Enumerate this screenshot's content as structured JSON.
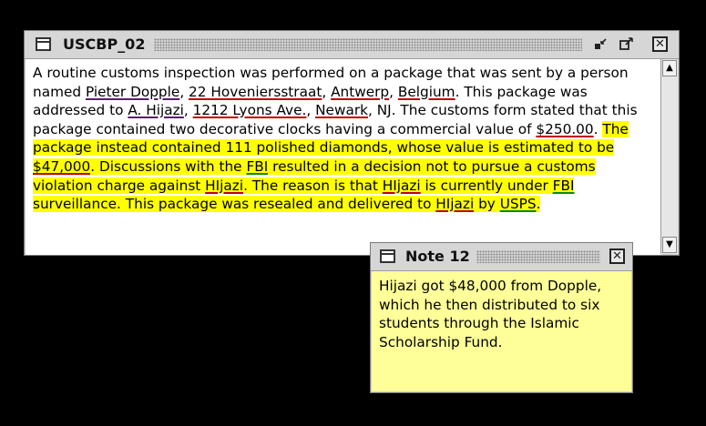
{
  "main_window": {
    "title": "USCBP_02",
    "minimize_glyph": "▫↙",
    "maximize_glyph": "↗",
    "close_glyph": "✕",
    "text": {
      "p1": "A routine customs inspection was performed on a package that was sent by a person named ",
      "name1": "Pieter Dopple",
      "sep1": ", ",
      "addr1": "22 Hoveniersstraat",
      "sep2": ", ",
      "city1": "Antwerp",
      "sep3": ", ",
      "country1": "Belgium",
      "p2": ". This package was addressed to ",
      "name2": "A. Hijazi",
      "sep4": ", ",
      "addr2": "1212 Lyons Ave.",
      "sep5": ", ",
      "city2": "Newark",
      "p3": ", NJ. The customs form stated that this package contained two decorative clocks having a commercial value of ",
      "value1": "$250.00",
      "p4": ". ",
      "h1": "The package instead contained 111 polished diamonds, whose value is estimated to be ",
      "value2": "$47,000",
      "h2": ". Discussions with the ",
      "org1": "FBI",
      "h3": " resulted in a decision not to pursue a customs violation charge against ",
      "name3": "HIjazi",
      "h4": ". The reason is that ",
      "name4": "HIjazi",
      "h5": " is currently under ",
      "org2": "FBI",
      "h6": " surveillance. This package was resealed and delivered to ",
      "name5": "HIjazi",
      "h7": " by ",
      "org3": "USPS",
      "h8": "."
    },
    "scroll_up": "▲",
    "scroll_down": "▼"
  },
  "note_window": {
    "title": "Note 12",
    "close_glyph": "✕",
    "text": "Hijazi got $48,000 from Dopple, which he then distributed to six students through the Islamic Scholarship Fund."
  },
  "colors": {
    "highlight": "#ffff00",
    "note_background": "#ffff99",
    "underline_person": "#c00000",
    "underline_org": "#0a8a0a",
    "underline_name": "#5a1f6e"
  },
  "icons": {
    "window_icon": "window-icon",
    "minimize": "minimize-icon",
    "maximize": "maximize-icon",
    "close": "close-icon"
  }
}
